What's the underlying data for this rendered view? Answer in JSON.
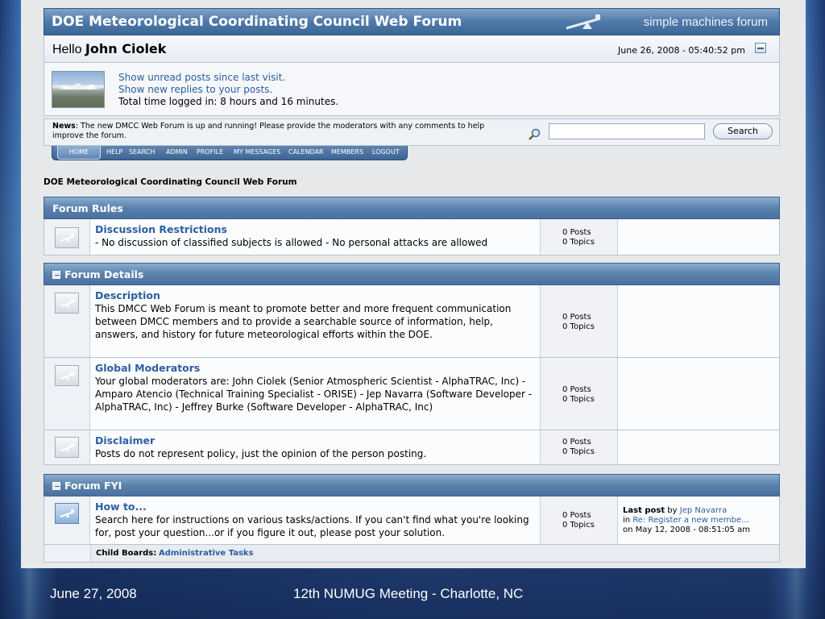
{
  "header": {
    "forum_title": "DOE Meteorological Coordinating Council Web Forum",
    "logo_text": "simple machines forum"
  },
  "user": {
    "greeting": "Hello",
    "name": "John Ciolek",
    "datetime": "June 26, 2008 - 05:40:52 pm",
    "links": [
      "Show unread posts since last visit.",
      "Show new replies to your posts."
    ],
    "time_logged": "Total time logged in: 8 hours and 16 minutes."
  },
  "news": {
    "label": "News",
    "text": ": The new DMCC Web Forum is up and running!  Please provide the moderators with any comments to help improve the forum."
  },
  "search": {
    "value": "",
    "button_label": "Search"
  },
  "menu": {
    "items": [
      "HOME",
      "HELP",
      "SEARCH",
      "ADMIN",
      "PROFILE",
      "MY MESSAGES",
      "CALENDAR",
      "MEMBERS",
      "LOGOUT"
    ],
    "active": "HOME"
  },
  "breadcrumb": "DOE Meteorological Coordinating Council Web Forum",
  "categories": [
    {
      "title": "Forum Rules",
      "boards": [
        {
          "name": "Discussion Restrictions",
          "description": "- No discussion of classified subjects is allowed - No personal attacks are allowed",
          "posts": "0 Posts",
          "topics": "0 Topics"
        }
      ]
    },
    {
      "title": "Forum Details",
      "boards": [
        {
          "name": "Description",
          "description": "This DMCC Web Forum is meant to promote better and more frequent communication between DMCC members and to provide a searchable source of information, help, answers, and history for future meteorological efforts within the DOE.",
          "posts": "0 Posts",
          "topics": "0 Topics"
        },
        {
          "name": "Global Moderators",
          "description": "Your global moderators are: John Ciolek (Senior Atmospheric Scientist - AlphaTRAC, Inc) - Amparo Atencio (Technical Training Specialist - ORISE) - Jep Navarra (Software Developer - AlphaTRAC, Inc) - Jeffrey Burke (Software Developer - AlphaTRAC, Inc)",
          "posts": "0 Posts",
          "topics": "0 Topics"
        },
        {
          "name": "Disclaimer",
          "description": "Posts do not represent policy, just the opinion of the person posting.",
          "posts": "0 Posts",
          "topics": "0 Topics"
        }
      ]
    },
    {
      "title": "Forum FYI",
      "boards": [
        {
          "name": "How to...",
          "description": "Search here for instructions on various tasks/actions. If you can't find what you're looking for, post your question...or if you figure it out, please post your solution.",
          "posts": "0 Posts",
          "topics": "0 Topics",
          "last_post": {
            "label": "Last post",
            "by": "by",
            "author": "Jep Navarra",
            "in": "in",
            "topic": "Re: Register a new membe...",
            "on": "on May 12, 2008 - 08:51:05 am"
          }
        }
      ]
    }
  ],
  "child_boards": {
    "label": "Child Boards",
    "link": "Administrative Tasks"
  },
  "slide_footer": {
    "date": "June 27, 2008",
    "meeting": "12th NUMUG Meeting - Charlotte, NC"
  }
}
